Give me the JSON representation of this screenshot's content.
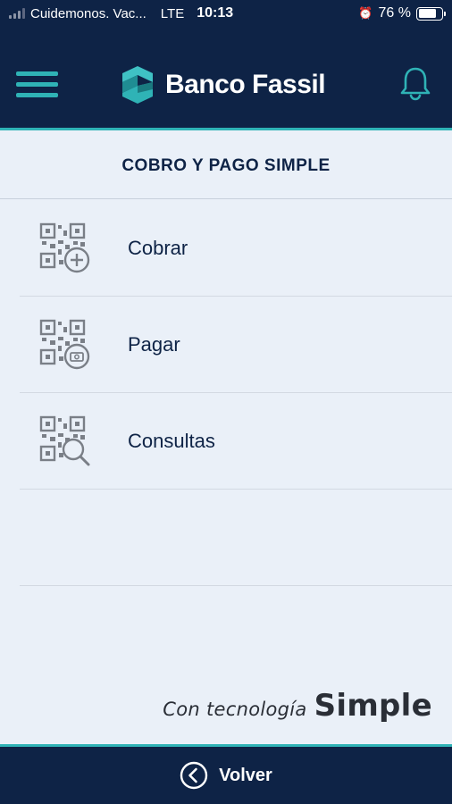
{
  "status_bar": {
    "carrier": "Cuidemonos. Vac...",
    "network": "LTE",
    "time": "10:13",
    "battery": "76 %",
    "battery_level": 0.76
  },
  "header": {
    "brand_name": "Banco Fassil",
    "menu_icon": "hamburger-menu-icon",
    "notification_icon": "bell-icon",
    "accent_color": "#2fb3b6",
    "background_color": "#0e2346"
  },
  "page": {
    "title": "COBRO Y PAGO SIMPLE"
  },
  "menu": {
    "items": [
      {
        "label": "Cobrar",
        "icon": "qr-plus-icon"
      },
      {
        "label": "Pagar",
        "icon": "qr-pay-icon"
      },
      {
        "label": "Consultas",
        "icon": "qr-search-icon"
      }
    ]
  },
  "footer": {
    "tagline": "Con tecnología",
    "tagline_brand": "Simple",
    "back_label": "Volver"
  }
}
